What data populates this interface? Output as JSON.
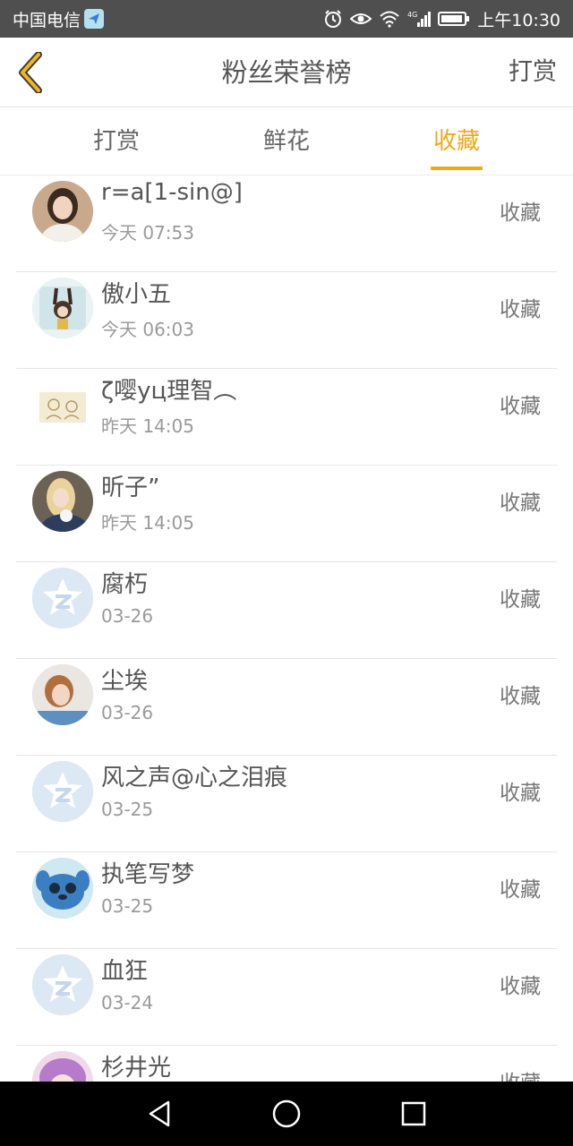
{
  "status_bar": {
    "carrier": "中国电信",
    "time": "上午10:30",
    "network": "4G",
    "icons": [
      "app-notification-icon",
      "alarm-icon",
      "eye-icon",
      "wifi-icon",
      "signal-icon",
      "battery-icon"
    ]
  },
  "nav": {
    "title": "粉丝荣誉榜",
    "action": "打赏"
  },
  "tabs": [
    {
      "label": "打赏",
      "active": false
    },
    {
      "label": "鲜花",
      "active": false
    },
    {
      "label": "收藏",
      "active": true
    }
  ],
  "colors": {
    "accent": "#f0a81a",
    "status_bar": "#4f4f4f",
    "text": "#555555",
    "subtext": "#9a9a9a",
    "divider": "#e5e5e5"
  },
  "rows": [
    {
      "name": "r=a[1-sin@]",
      "time": "今天 07:53",
      "button": "收藏",
      "avatar": "avatar-photo-woman"
    },
    {
      "name": "傲小五",
      "time": "今天 06:03",
      "button": "收藏",
      "avatar": "avatar-cartoon-bunny"
    },
    {
      "name": "ζ嘤уц理智︵",
      "time": "昨天 14:05",
      "button": "收藏",
      "avatar": "avatar-sketch"
    },
    {
      "name": "昕子”",
      "time": "昨天 14:05",
      "button": "收藏",
      "avatar": "avatar-photo-blonde"
    },
    {
      "name": "腐朽",
      "time": "03-26",
      "button": "收藏",
      "avatar": "avatar-default"
    },
    {
      "name": "尘埃",
      "time": "03-26",
      "button": "收藏",
      "avatar": "avatar-photo-girl"
    },
    {
      "name": "风之声@心之泪痕",
      "time": "03-25",
      "button": "收藏",
      "avatar": "avatar-default"
    },
    {
      "name": "执笔写梦",
      "time": "03-25",
      "button": "收藏",
      "avatar": "avatar-stitch"
    },
    {
      "name": "血狂",
      "time": "03-24",
      "button": "收藏",
      "avatar": "avatar-default"
    },
    {
      "name": "杉井光",
      "time": "",
      "button": "收藏",
      "avatar": "avatar-anime"
    }
  ],
  "system_nav": [
    "back-triangle-icon",
    "home-circle-icon",
    "recents-square-icon"
  ]
}
